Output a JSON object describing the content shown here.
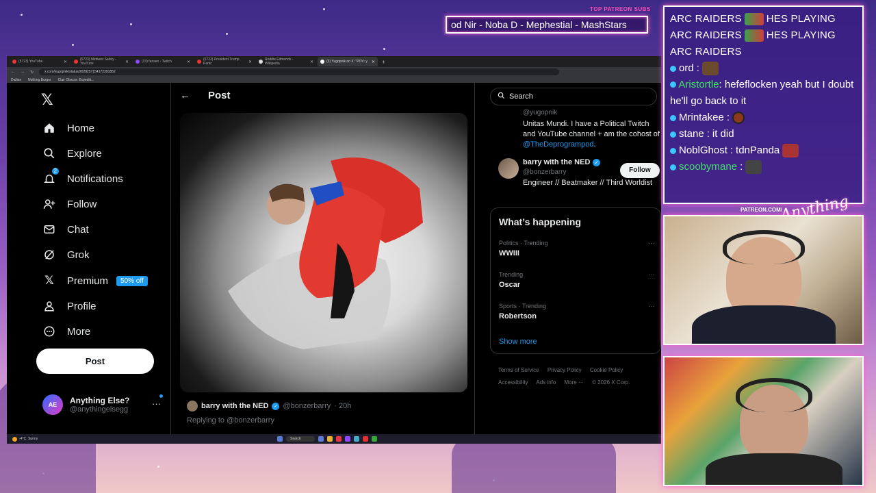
{
  "overlay": {
    "subs_title": "TOP PATREON SUBS",
    "subs_ticker": "od Nir - Noba D - Mephestial - MashStars",
    "patreon_tag": "PATREON.COM/",
    "signature": "Anything Else?"
  },
  "browser": {
    "tabs": [
      {
        "label": "(5723) YouTube"
      },
      {
        "label": "(5723) Midwest Safety - YouTube"
      },
      {
        "label": "(33) fansen - Twitch"
      },
      {
        "label": "(5723) President Trump Partic"
      },
      {
        "label": "Roddie Edmonds - Wikipedia"
      },
      {
        "label": "(3) Yugopnik on X: \"POV: y"
      }
    ],
    "url": "x.com/yugopnik/status/2028257154172391852",
    "bookmarks": [
      "Dailies",
      "Nothing Burger",
      "Clair Obscur: Expediti..."
    ]
  },
  "nav": {
    "items": [
      {
        "label": "Home",
        "icon": "home-icon"
      },
      {
        "label": "Explore",
        "icon": "search-icon"
      },
      {
        "label": "Notifications",
        "icon": "bell-icon"
      },
      {
        "label": "Follow",
        "icon": "add-person-icon"
      },
      {
        "label": "Chat",
        "icon": "mail-icon"
      },
      {
        "label": "Grok",
        "icon": "grok-icon"
      },
      {
        "label": "Premium",
        "icon": "x-icon"
      },
      {
        "label": "Profile",
        "icon": "person-icon"
      },
      {
        "label": "More",
        "icon": "more-circle-icon"
      }
    ],
    "premium_badge": "50% off",
    "post_label": "Post",
    "account_name": "Anything Else?",
    "account_handle": "@anythingelsegg",
    "account_avatar_text": "AE",
    "notification_count": "2"
  },
  "center": {
    "header_title": "Post",
    "tweet_author": "barry with the NED",
    "tweet_handle": "@bonzerbarry",
    "tweet_time": "· 20h",
    "replying_to": "Replying to @bonzerbarry"
  },
  "right": {
    "search_placeholder": "Search",
    "bio_handle": "@yugopnik",
    "bio_text": "Unitas Mundi. I have a Political Twitch and YouTube channel + am the cohost of ",
    "bio_link": "@TheDeprogrampod",
    "bio_end": ".",
    "suggest_name": "barry with the NED",
    "suggest_handle": "@bonzerbarry",
    "suggest_desc": "Engineer // Beatmaker // Third Worldist",
    "follow_label": "Follow",
    "happening_title": "What’s happening",
    "trends": [
      {
        "category": "Politics · Trending",
        "topic": "WWIII"
      },
      {
        "category": "Trending",
        "topic": "Oscar"
      },
      {
        "category": "Sports · Trending",
        "topic": "Robertson"
      }
    ],
    "show_more": "Show more",
    "footer": [
      "Terms of Service",
      "Privacy Policy",
      "Cookie Policy",
      "Accessibility",
      "Ads info",
      "More ···",
      "© 2026 X Corp."
    ]
  },
  "taskbar": {
    "weather_temp": "-4°C",
    "weather_desc": "Sunny",
    "search": "Search"
  },
  "chat": {
    "raid_line": "ARC RAIDERS",
    "raid_suffix": "HES PLAYING",
    "messages": [
      {
        "user": "ord",
        "text": ""
      },
      {
        "user": "Aristortle",
        "text": "hefeflocken yeah but I doubt he'll go back to it"
      },
      {
        "user": "Mrintakee",
        "text": ""
      },
      {
        "user": "stane",
        "text": "it did"
      },
      {
        "user": "NoblGhost",
        "text": "tdnPanda"
      },
      {
        "user": "scoobymane",
        "text": ""
      }
    ]
  }
}
